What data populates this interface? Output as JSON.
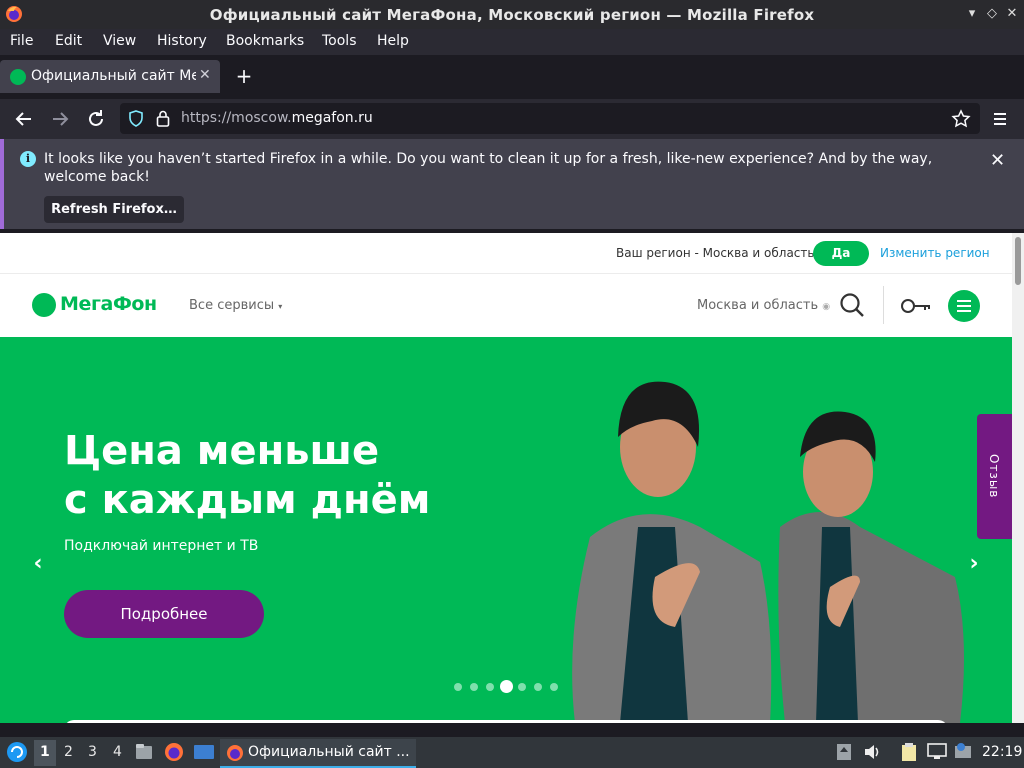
{
  "window": {
    "title": "Официальный сайт МегаФона, Московский регион — Mozilla Firefox"
  },
  "menubar": {
    "items": [
      "File",
      "Edit",
      "View",
      "History",
      "Bookmarks",
      "Tools",
      "Help"
    ]
  },
  "tabs": [
    {
      "title": "Официальный сайт МегаФона, Московский регион",
      "active": true
    }
  ],
  "navbar": {
    "url_prefix": "https://moscow.",
    "url_domain": "megafon.ru"
  },
  "notification": {
    "message": "It looks like you haven’t started Firefox in a while. Do you want to clean it up for a fresh, like-new experience? And by the way, welcome back!",
    "button": "Refresh Firefox…"
  },
  "page": {
    "region_bar": {
      "question": "Ваш регион - Москва и область?",
      "confirm": "Да",
      "change": "Изменить регион"
    },
    "header": {
      "logo": "МегаФон",
      "services": "Все сервисы",
      "city": "Москва и область"
    },
    "hero": {
      "title_line1": "Цена меньше",
      "title_line2": "с каждым днём",
      "subtitle": "Подключай интернет и ТВ",
      "cta": "Подробнее",
      "slides": 7,
      "active_slide": 4
    },
    "feedback": "Отзыв",
    "colors": {
      "brand_green": "#00b956",
      "brand_purple": "#731982"
    }
  },
  "taskbar": {
    "workspaces": [
      "1",
      "2",
      "3",
      "4"
    ],
    "active_workspace": "1",
    "task_title": "Официальный сайт ...",
    "clock": "22:19"
  }
}
